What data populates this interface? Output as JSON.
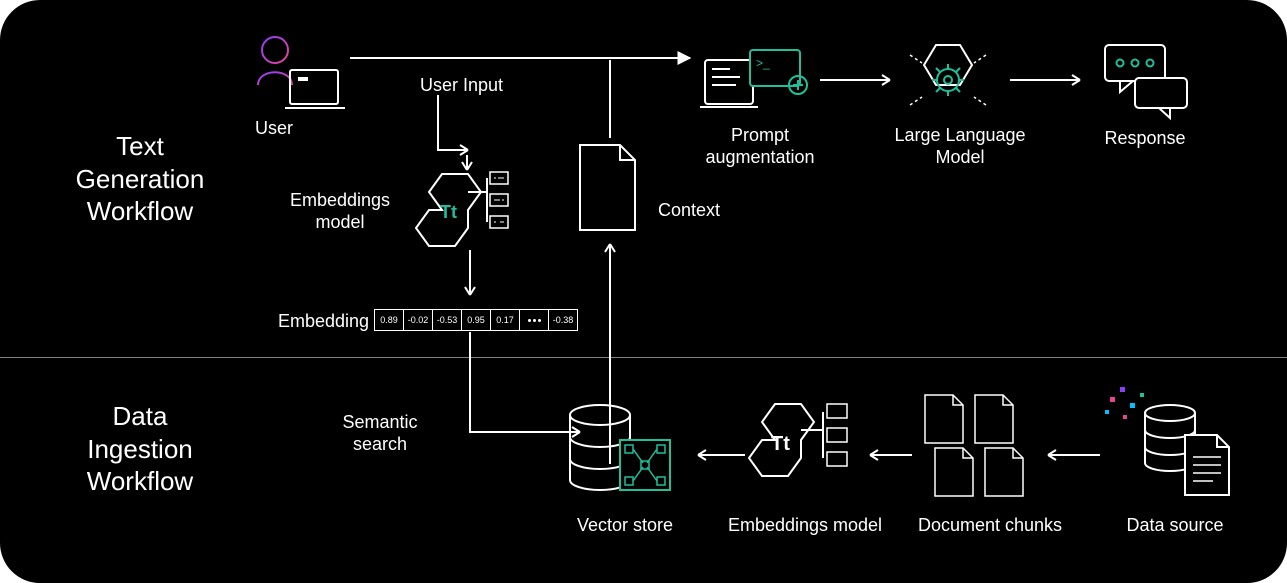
{
  "sections": {
    "top_title": "Text\nGeneration\nWorkflow",
    "bottom_title": "Data\nIngestion\nWorkflow"
  },
  "nodes": {
    "user": "User",
    "user_input": "User Input",
    "embeddings_model_top": "Embeddings\nmodel",
    "embedding": "Embedding",
    "context": "Context",
    "prompt_aug": "Prompt\naugmentation",
    "llm": "Large Language\nModel",
    "response": "Response",
    "semantic_search": "Semantic\nsearch",
    "vector_store": "Vector store",
    "embeddings_model_bottom": "Embeddings model",
    "document_chunks": "Document chunks",
    "data_source": "Data source"
  },
  "vector": [
    "0.89",
    "-0.02",
    "-0.53",
    "0.95",
    "0.17",
    "•••",
    "-0.38"
  ],
  "colors": {
    "accent": "#1fbf9c",
    "grad1": "#8a3ffc",
    "grad2": "#e84393",
    "grad3": "#00c2ff"
  }
}
